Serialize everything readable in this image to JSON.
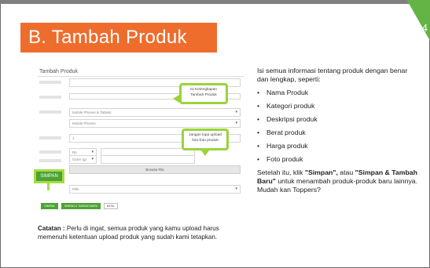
{
  "slide": {
    "title": "B. Tambah Produk",
    "page_number": "4",
    "accent_orange": "#ee6d2d",
    "accent_green": "#64b345"
  },
  "screenshot": {
    "form_title": "Tambah Produk",
    "fields": {
      "category_1": "Mobile Phones & Tablets",
      "category_2": "Mobile Phones",
      "quantity": "1",
      "weight_unit_1": "Rp",
      "weight_unit_2": "Gram (g)",
      "browse_label": "Browse File",
      "dropdown_bottom": "Pilih"
    },
    "callouts": {
      "top": "Isi Kelengkapan Tambah Produk",
      "middle": "Jangan lupa upload foto-foto produk"
    },
    "buttons": {
      "simpan_big": "SIMPAN",
      "simpan_small": "SIMPAN",
      "simpan_tambah": "SIMPAN & TAMBAH BARU",
      "batal": "BATAL"
    }
  },
  "notes": {
    "label": "Catatan :",
    "text": "Perlu di ingat, semua produk yang kamu upload harus memenuhi ketentuan upload produk yang sudah kami tetapkan."
  },
  "right_panel": {
    "intro": "Isi semua informasi tentang produk dengan benar dan lengkap, seperti:",
    "items": [
      "Nama Produk",
      "Kategori produk",
      "Deskripsi produk",
      "Berat produk",
      "Harga produk",
      "Foto produk"
    ],
    "after_1": "Setelah itu, klik ",
    "simpan_q": "\"Simpan\",",
    "after_2": " atau ",
    "simpan_tambah_q": "\"Simpan & Tambah Baru\"",
    "after_3": " untuk menambah produk-produk baru lainnya. Mudah kan Toppers?"
  }
}
